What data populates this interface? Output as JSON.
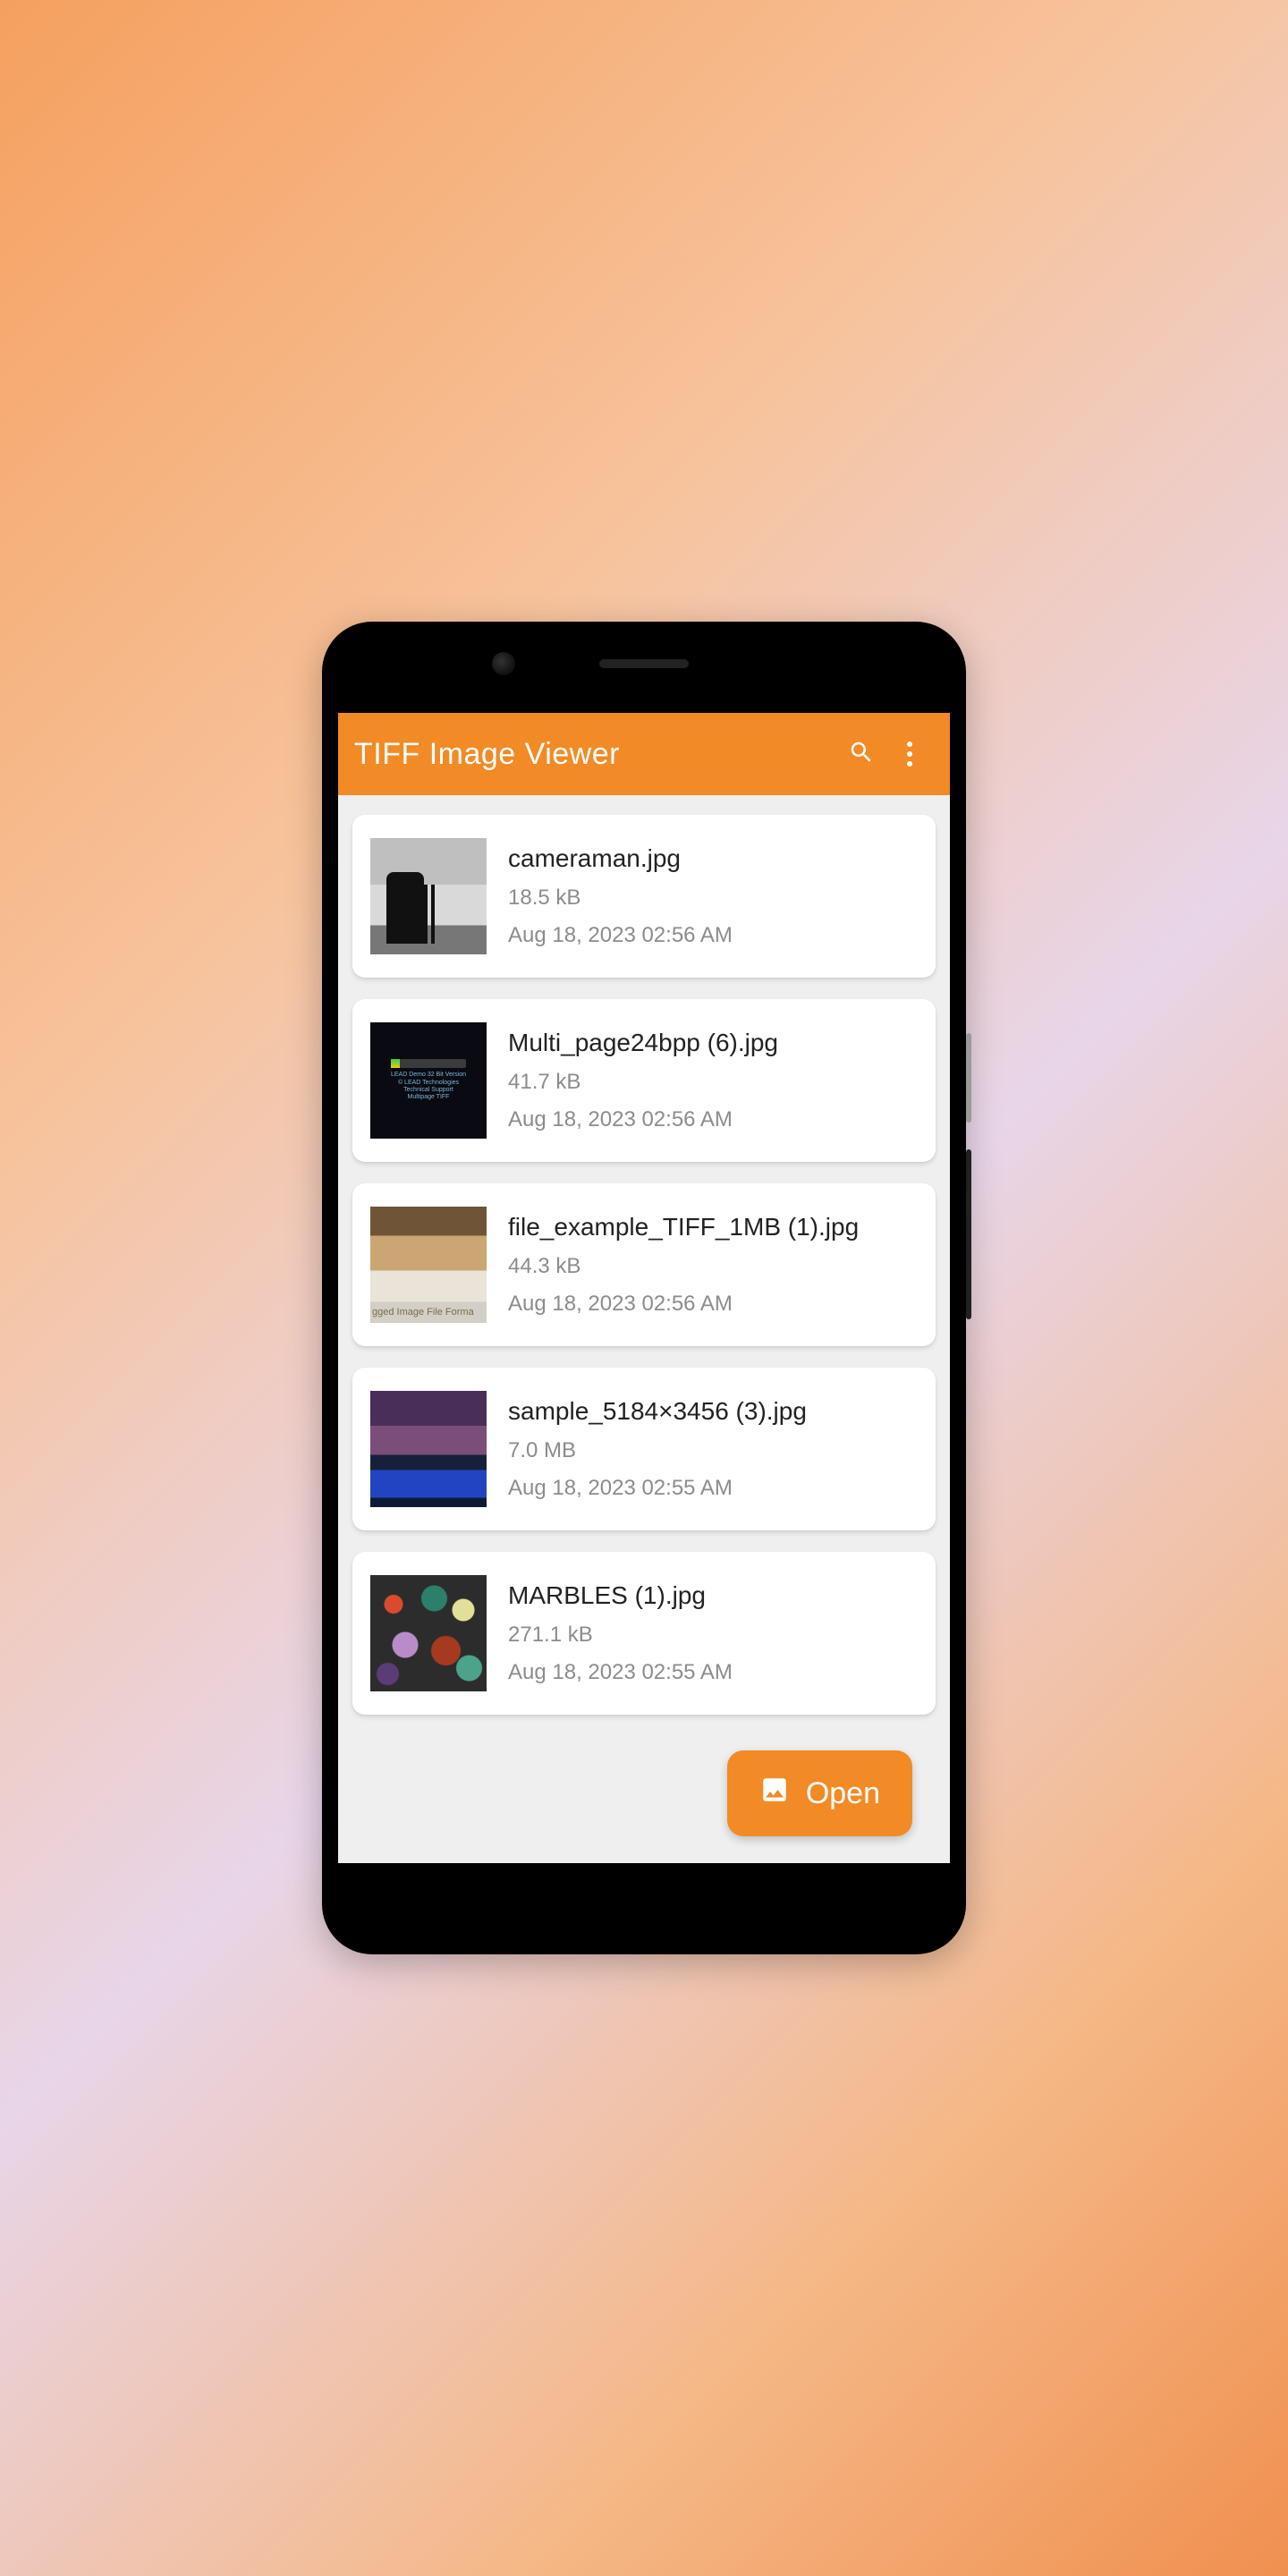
{
  "appbar": {
    "title": "TIFF Image Viewer"
  },
  "files": [
    {
      "name": "cameraman.jpg",
      "size": "18.5 kB",
      "date": "Aug 18, 2023 02:56 AM"
    },
    {
      "name": "Multi_page24bpp (6).jpg",
      "size": "41.7 kB",
      "date": "Aug 18, 2023 02:56 AM"
    },
    {
      "name": "file_example_TIFF_1MB (1).jpg",
      "size": "44.3 kB",
      "date": "Aug 18, 2023 02:56 AM"
    },
    {
      "name": "sample_5184×3456 (3).jpg",
      "size": "7.0 MB",
      "date": "Aug 18, 2023 02:55 AM"
    },
    {
      "name": "MARBLES (1).jpg",
      "size": "271.1 kB",
      "date": "Aug 18, 2023 02:55 AM"
    }
  ],
  "fab": {
    "label": "Open"
  }
}
